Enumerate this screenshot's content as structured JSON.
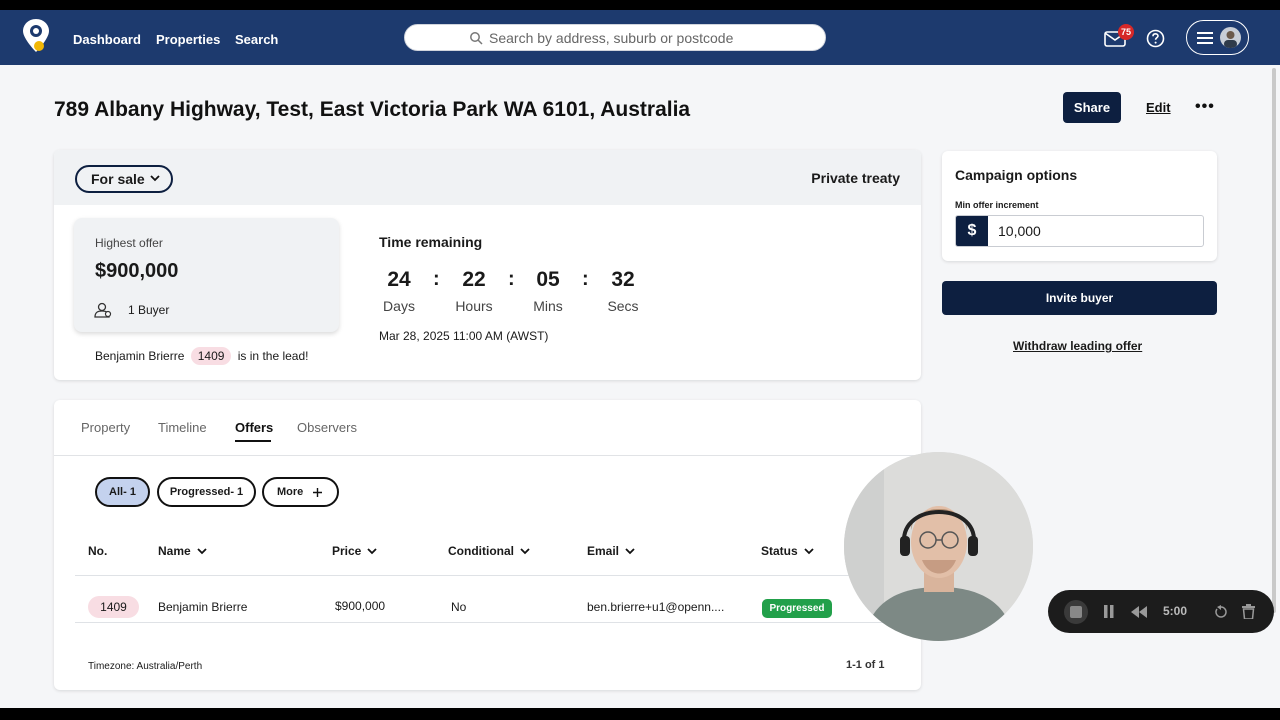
{
  "header": {
    "nav": [
      "Dashboard",
      "Properties",
      "Search"
    ],
    "search_placeholder": "Search by address, suburb or postcode",
    "mail_count": "75"
  },
  "page": {
    "title": "789 Albany Highway, Test, East Victoria Park WA 6101, Australia",
    "share_label": "Share",
    "edit_label": "Edit",
    "more_label": "•••"
  },
  "sale": {
    "status": "For sale",
    "method": "Private treaty",
    "highest_offer_label": "Highest offer",
    "highest_offer_value": "$900,000",
    "buyer_count_text": "1 Buyer",
    "lead_name": "Benjamin Brierre",
    "lead_number": "1409",
    "lead_suffix": "is in the lead!",
    "time_remaining_label": "Time remaining",
    "countdown": [
      {
        "value": "24",
        "unit": "Days"
      },
      {
        "value": "22",
        "unit": "Hours"
      },
      {
        "value": "05",
        "unit": "Mins"
      },
      {
        "value": "32",
        "unit": "Secs"
      }
    ],
    "deadline": "Mar 28, 2025 11:00 AM (AWST)"
  },
  "campaign": {
    "title": "Campaign options",
    "min_increment_label": "Min offer increment",
    "currency": "$",
    "min_increment_value": "10,000",
    "invite_label": "Invite buyer",
    "withdraw_label": "Withdraw leading offer"
  },
  "offers": {
    "tabs": [
      "Property",
      "Timeline",
      "Offers",
      "Observers"
    ],
    "active_tab": "Offers",
    "filters": [
      "All- 1",
      "Progressed- 1",
      "More"
    ],
    "columns": [
      "No.",
      "Name",
      "Price",
      "Conditional",
      "Email",
      "Status"
    ],
    "rows": [
      {
        "no": "1409",
        "name": "Benjamin Brierre",
        "price": "$900,000",
        "conditional": "No",
        "email": "ben.brierre+u1@openn....",
        "status": "Progressed"
      }
    ],
    "timezone": "Timezone: Australia/Perth",
    "pagination": "1-1 of 1"
  },
  "recorder": {
    "time": "5:00"
  },
  "colors": {
    "brand_navy": "#1d3a6e",
    "button_navy": "#0d1f40",
    "progressed_green": "#22a04a",
    "badge_pink": "#f8dde3",
    "chip_active": "#c4d2ee"
  },
  "icons": [
    "pin-logo-icon",
    "search-icon",
    "mail-icon",
    "help-icon",
    "hamburger-icon",
    "chevron-down-icon",
    "buyer-icon",
    "plus-icon",
    "stop-icon",
    "pause-icon",
    "rewind-icon",
    "restart-icon",
    "trash-icon"
  ]
}
